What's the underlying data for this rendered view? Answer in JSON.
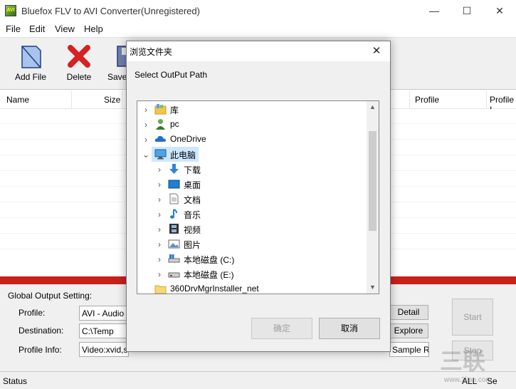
{
  "window": {
    "title": "Bluefox FLV to AVI Converter(Unregistered)",
    "icon_text": "AVI",
    "min_glyph": "—",
    "max_glyph": "☐",
    "close_glyph": "✕"
  },
  "menu": [
    "File",
    "Edit",
    "View",
    "Help"
  ],
  "toolbar": {
    "add_file": "Add File",
    "delete": "Delete",
    "save": "Save"
  },
  "list": {
    "columns": {
      "name": "Name",
      "size": "Size",
      "profile": "Profile",
      "profile2": "Profile I"
    }
  },
  "output": {
    "section_label": "Global Output Setting:",
    "profile_label": "Profile:",
    "profile_value": "AVI - Audio V",
    "destination_label": "Destination:",
    "destination_value": "C:\\Temp",
    "profile_info_label": "Profile Info:",
    "profile_info_value": "Video:xvid,siz",
    "detail_button": "Detail",
    "explore_button": "Explore",
    "sample_rate_text": "Sample Ra",
    "start_button": "Start",
    "stop_button": "Stop"
  },
  "status": {
    "label": "Status",
    "all": "ALL",
    "se": "Se"
  },
  "dialog": {
    "title": "浏览文件夹",
    "close_glyph": "✕",
    "prompt": "Select OutPut Path",
    "tree": [
      {
        "label": "库",
        "icon": "library-icon",
        "expander": "›"
      },
      {
        "label": "pc",
        "icon": "user-icon",
        "expander": "›"
      },
      {
        "label": "OneDrive",
        "icon": "onedrive-cloud-icon",
        "expander": "›"
      },
      {
        "label": "此电脑",
        "icon": "computer-icon",
        "expander": "⌄"
      },
      {
        "label": "下载",
        "icon": "download-arrow-icon",
        "expander": "›"
      },
      {
        "label": "桌面",
        "icon": "desktop-icon",
        "expander": "›"
      },
      {
        "label": "文档",
        "icon": "document-icon",
        "expander": "›"
      },
      {
        "label": "音乐",
        "icon": "music-note-icon",
        "expander": "›"
      },
      {
        "label": "视频",
        "icon": "film-icon",
        "expander": "›"
      },
      {
        "label": "图片",
        "icon": "picture-icon",
        "expander": "›"
      },
      {
        "label": "本地磁盘 (C:)",
        "icon": "local-disk-c-icon",
        "expander": "›"
      },
      {
        "label": "本地磁盘 (E:)",
        "icon": "local-disk-e-icon",
        "expander": "›"
      },
      {
        "label": "360DrvMgrInstaller_net",
        "icon": "folder-icon",
        "expander": ""
      }
    ],
    "ok_button": "确定",
    "cancel_button": "取消"
  },
  "watermark": {
    "main": "三联",
    "sub": "www.3lian.com"
  },
  "colors": {
    "accent_red": "#c9201a",
    "selection": "#cce8ff"
  }
}
